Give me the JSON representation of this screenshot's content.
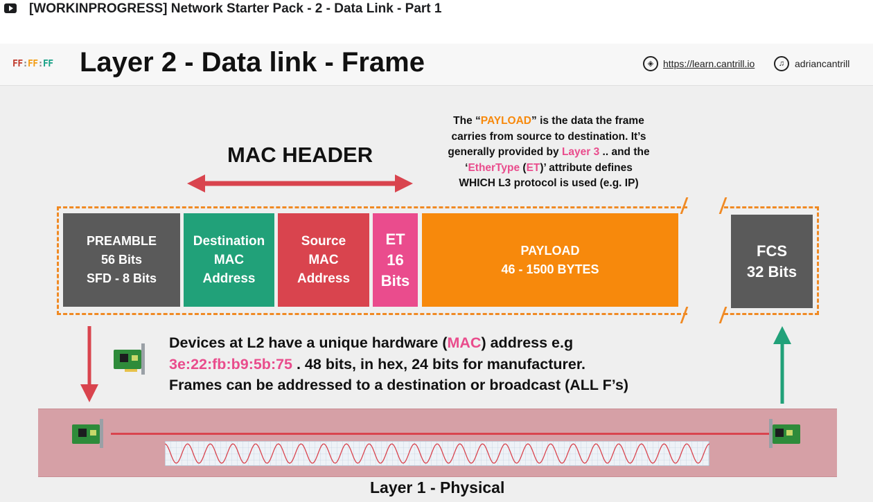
{
  "video": {
    "title": "[WORKINPROGRESS] Network Starter Pack - 2 - Data Link - Part 1",
    "play_icon": "play-icon"
  },
  "slide": {
    "logo": {
      "part1": "FF",
      "sep1": ":",
      "part2": "FF",
      "sep2": ":",
      "part3": "FF"
    },
    "title": "Layer 2 - Data link - Frame",
    "link": "https://learn.cantrill.io",
    "twitter": "adriancantrill",
    "mac_header": "MAC HEADER",
    "payload_desc": {
      "l1_pre": "The “",
      "l1_hl": "PAYLOAD",
      "l1_post": "” is the data the frame",
      "l2": "carries from source to destination. It’s",
      "l3_pre": "generally provided by ",
      "l3_hl": "Layer 3",
      "l3_post": " .. and the",
      "l4_pre": "‘",
      "l4_hl1": "EtherType",
      "l4_mid1": " (",
      "l4_hl2": "ET",
      "l4_post": ")’ attribute defines",
      "l5": "WHICH L3 protocol is used (e.g. IP)"
    },
    "frame": {
      "preamble": "PREAMBLE\n56 Bits\nSFD - 8 Bits",
      "destination": "Destination\nMAC\nAddress",
      "source": "Source\nMAC\nAddress",
      "et": "ET\n16\nBits",
      "payload": "PAYLOAD\n46 - 1500 BYTES",
      "fcs": "FCS\n32 Bits"
    },
    "devices": {
      "l1_pre": "Devices at L2 have a unique hardware (",
      "l1_hl": "MAC",
      "l1_post": ") address e.g",
      "l2_hl": "3e:22:fb:b9:5b:75",
      "l2_post": " . 48 bits, in hex, 24 bits for manufacturer.",
      "l3": "Frames can be addressed to a destination or broadcast (ALL F’s)"
    },
    "layer1_label": "Layer 1 - Physical",
    "colors": {
      "orange": "#f7890c",
      "pink": "#ea4c8d",
      "red": "#d9444e",
      "green": "#21a179",
      "gray": "#5a5a5a"
    }
  }
}
